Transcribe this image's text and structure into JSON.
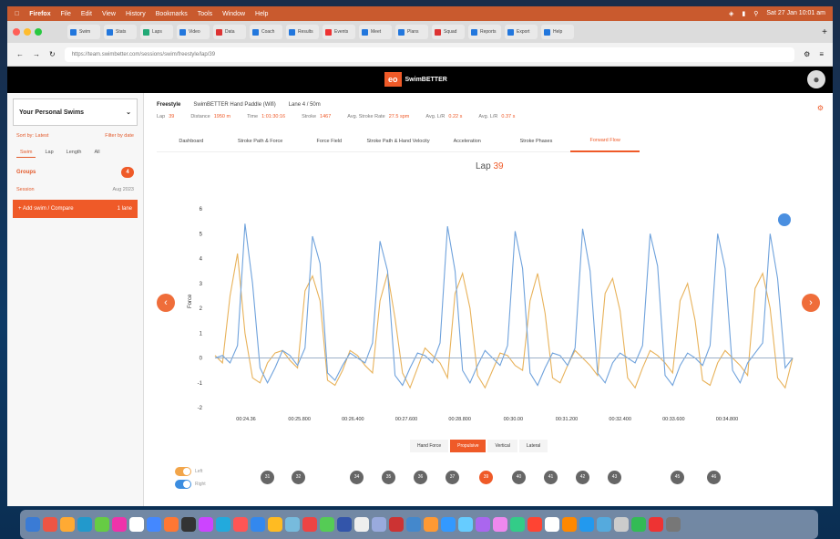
{
  "menubar": {
    "app": "Firefox",
    "items": [
      "File",
      "Edit",
      "View",
      "History",
      "Bookmarks",
      "Tools",
      "Window",
      "Help"
    ],
    "clock": "Sat 27 Jan 10:01 am"
  },
  "browser": {
    "url": "https://team.swimbetter.com/sessions/swim/freestyle/lap/39",
    "tab_labels": [
      "Swim",
      "Stats",
      "Laps",
      "Video",
      "Data",
      "Coach",
      "Results",
      "Events",
      "Meet",
      "Plans",
      "Squad",
      "Reports",
      "Export",
      "Help"
    ]
  },
  "app": {
    "brand_mark": "eo",
    "brand_name": "SwimBETTER"
  },
  "sidebar": {
    "sessions_title": "Your Personal Swims",
    "date_label": "Sort by: Latest",
    "date_right": "Filter by date",
    "tabs": [
      "Swim",
      "Lap",
      "Length",
      "All"
    ],
    "group_label": "Groups",
    "group_count": "4",
    "sub_label": "Session",
    "sub_right": "Aug 2023",
    "add_button": "+ Add swim / Compare",
    "add_right": "1 lane"
  },
  "stats": {
    "stroke": "Freestyle",
    "device": "SwimBETTER Hand Paddle (Wifi)",
    "lane": "Lane 4 / 50m",
    "items": [
      {
        "label": "Lap",
        "value": "39"
      },
      {
        "label": "Distance",
        "value": "1950 m"
      },
      {
        "label": "Time",
        "value": "1:01:30:16"
      },
      {
        "label": "Stroke",
        "value": "1467"
      },
      {
        "label": "Avg. Stroke Rate",
        "value": "27.5 spm"
      },
      {
        "label": "Avg. L/R",
        "value": "0.22 s"
      },
      {
        "label": "Avg. L/R",
        "value": "0.37 s"
      }
    ]
  },
  "tabs": [
    "Dashboard",
    "Stroke Path & Force",
    "Force Field",
    "Stroke Path & Hand Velocity",
    "Acceleration",
    "Stroke Phases",
    "Forward Flow"
  ],
  "active_tab": "Forward Flow",
  "lap_title": {
    "label": "Lap",
    "value": "39"
  },
  "chart_data": {
    "type": "line",
    "ylabel": "Force",
    "ylim": [
      -2,
      6
    ],
    "yticks": [
      6,
      5,
      4,
      3,
      2,
      1,
      0,
      -1,
      -2
    ],
    "xticks": [
      "00:24.36",
      "00:25.800",
      "00:26.400",
      "00:27.600",
      "00:28.800",
      "00:30.00",
      "00:31.200",
      "00:32.400",
      "00:33.600",
      "00:34.800"
    ],
    "series": [
      {
        "color": "#e8b25a",
        "values": [
          0.1,
          -0.2,
          2.5,
          4.2,
          1.0,
          -0.8,
          -1.0,
          -0.2,
          0.2,
          0.3,
          -0.1,
          -0.4,
          2.7,
          3.3,
          2.3,
          -0.9,
          -1.1,
          -0.5,
          0.3,
          0.1,
          -0.3,
          -0.6,
          2.3,
          3.4,
          1.6,
          -0.6,
          -1.2,
          -0.4,
          0.4,
          0.1,
          -0.2,
          -0.8,
          2.6,
          3.4,
          2.0,
          -0.7,
          -1.2,
          -0.5,
          0.2,
          0.1,
          -0.3,
          -0.5,
          2.3,
          3.4,
          1.8,
          -0.8,
          -1.0,
          -0.3,
          0.3,
          0.0,
          -0.3,
          -0.7,
          2.6,
          3.2,
          1.9,
          -0.8,
          -1.2,
          -0.4,
          0.3,
          0.1,
          -0.2,
          -0.6,
          2.3,
          3.0,
          1.5,
          -0.9,
          -1.1,
          -0.2,
          0.3,
          0.0,
          -0.3,
          -0.7,
          2.8,
          3.4,
          2.0,
          -0.8,
          -1.2,
          0.0
        ]
      },
      {
        "color": "#6fa2dc",
        "values": [
          0.0,
          0.1,
          -0.2,
          0.5,
          5.4,
          3.0,
          -0.4,
          -1.0,
          -0.4,
          0.3,
          0.1,
          -0.3,
          0.4,
          4.9,
          3.8,
          -0.6,
          -0.9,
          -0.3,
          0.2,
          0.0,
          -0.2,
          0.6,
          4.7,
          3.5,
          -0.7,
          -1.1,
          -0.4,
          0.2,
          0.1,
          -0.2,
          0.6,
          5.3,
          3.5,
          -0.5,
          -1.0,
          -0.3,
          0.3,
          0.0,
          -0.3,
          0.5,
          5.1,
          3.6,
          -0.6,
          -1.1,
          -0.4,
          0.2,
          0.1,
          -0.3,
          0.4,
          5.2,
          3.5,
          -0.6,
          -1.0,
          -0.2,
          0.2,
          0.0,
          -0.2,
          0.5,
          5.0,
          3.7,
          -0.7,
          -1.1,
          -0.3,
          0.2,
          0.0,
          -0.3,
          0.5,
          5.0,
          3.6,
          -0.5,
          -1.0,
          -0.2,
          0.2,
          0.6,
          5.0,
          3.2,
          -0.4,
          0.0
        ]
      },
      {
        "color": "#9bb0c8",
        "values": [
          0,
          0,
          0,
          0,
          0,
          0,
          0,
          0,
          0,
          0,
          0,
          0,
          0,
          0,
          0,
          0,
          0,
          0,
          0,
          0,
          0,
          0,
          0,
          0,
          0,
          0,
          0,
          0,
          0,
          0,
          0,
          0,
          0,
          0,
          0,
          0,
          0,
          0,
          0,
          0,
          0,
          0,
          0,
          0,
          0,
          0,
          0,
          0,
          0,
          0,
          0,
          0,
          0,
          0,
          0,
          0,
          0,
          0,
          0,
          0,
          0,
          0,
          0,
          0,
          0,
          0,
          0,
          0,
          0,
          0,
          0,
          0,
          0,
          0,
          0,
          0,
          0,
          0
        ]
      }
    ]
  },
  "modes": [
    "Hand Force",
    "Propulsive",
    "Vertical",
    "Lateral"
  ],
  "active_mode": "Propulsive",
  "toggles": [
    {
      "label": "Left",
      "color": "#f2a54a"
    },
    {
      "label": "Right",
      "color": "#3b8de0"
    }
  ],
  "laps": [
    "31",
    "32",
    "34",
    "35",
    "36",
    "37",
    "39",
    "40",
    "41",
    "42",
    "43",
    "45",
    "46"
  ],
  "active_lap": "39"
}
